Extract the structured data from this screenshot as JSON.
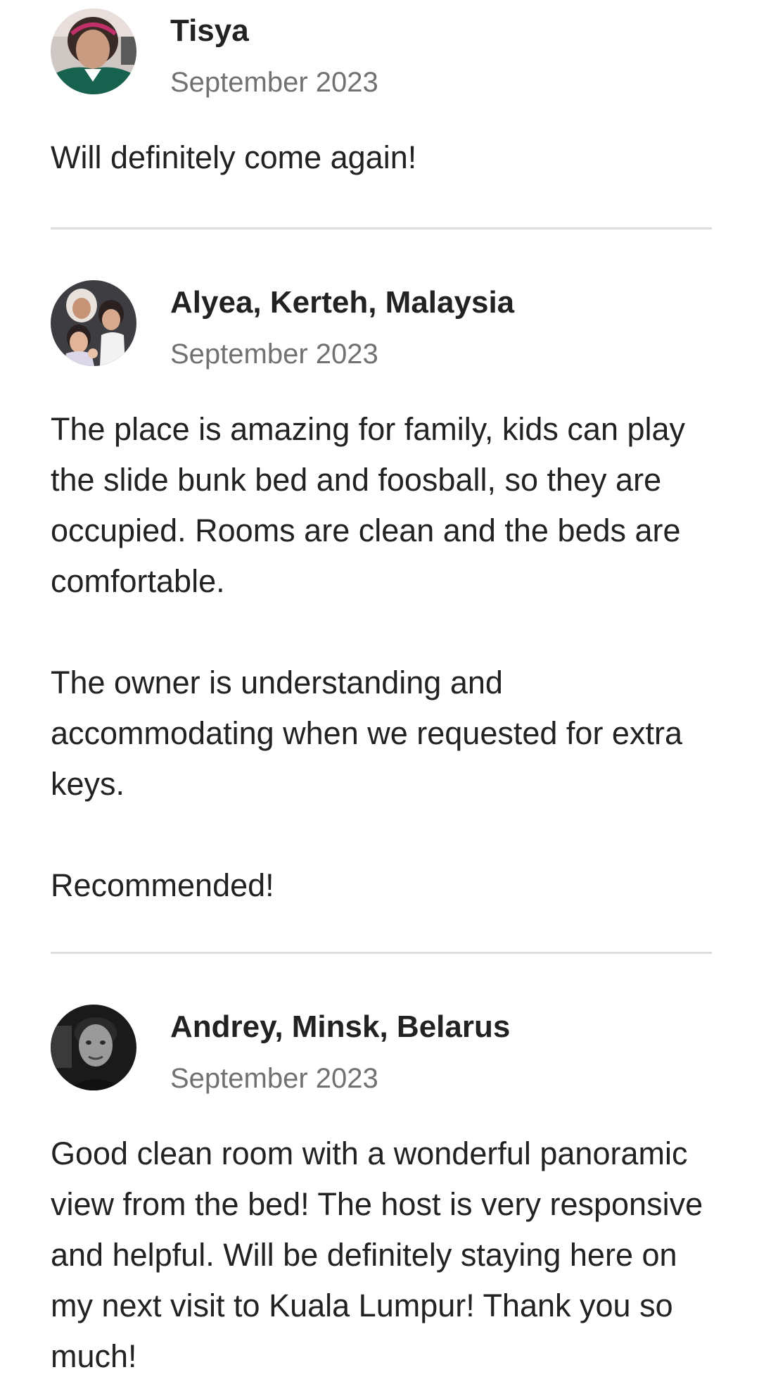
{
  "reviews": [
    {
      "name": "Tisya",
      "date": "September 2023",
      "paragraphs": [
        "Will definitely come again!"
      ]
    },
    {
      "name": "Alyea, Kerteh, Malaysia",
      "date": "September 2023",
      "paragraphs": [
        "The place is amazing for family, kids can play the slide bunk bed and foosball, so they are occupied. Rooms are clean and the beds are comfortable.",
        "The owner is understanding and accommodating when we requested for extra keys.",
        "Recommended!"
      ]
    },
    {
      "name": "Andrey, Minsk, Belarus",
      "date": "September 2023",
      "paragraphs": [
        "Good clean room with a wonderful panoramic view from the bed! The host is very responsive and helpful. Will be definitely staying here on my next visit to Kuala Lumpur! Thank you so much!"
      ]
    }
  ],
  "colors": {
    "text_primary": "#222222",
    "text_secondary": "#717171",
    "divider": "#dddddd"
  }
}
